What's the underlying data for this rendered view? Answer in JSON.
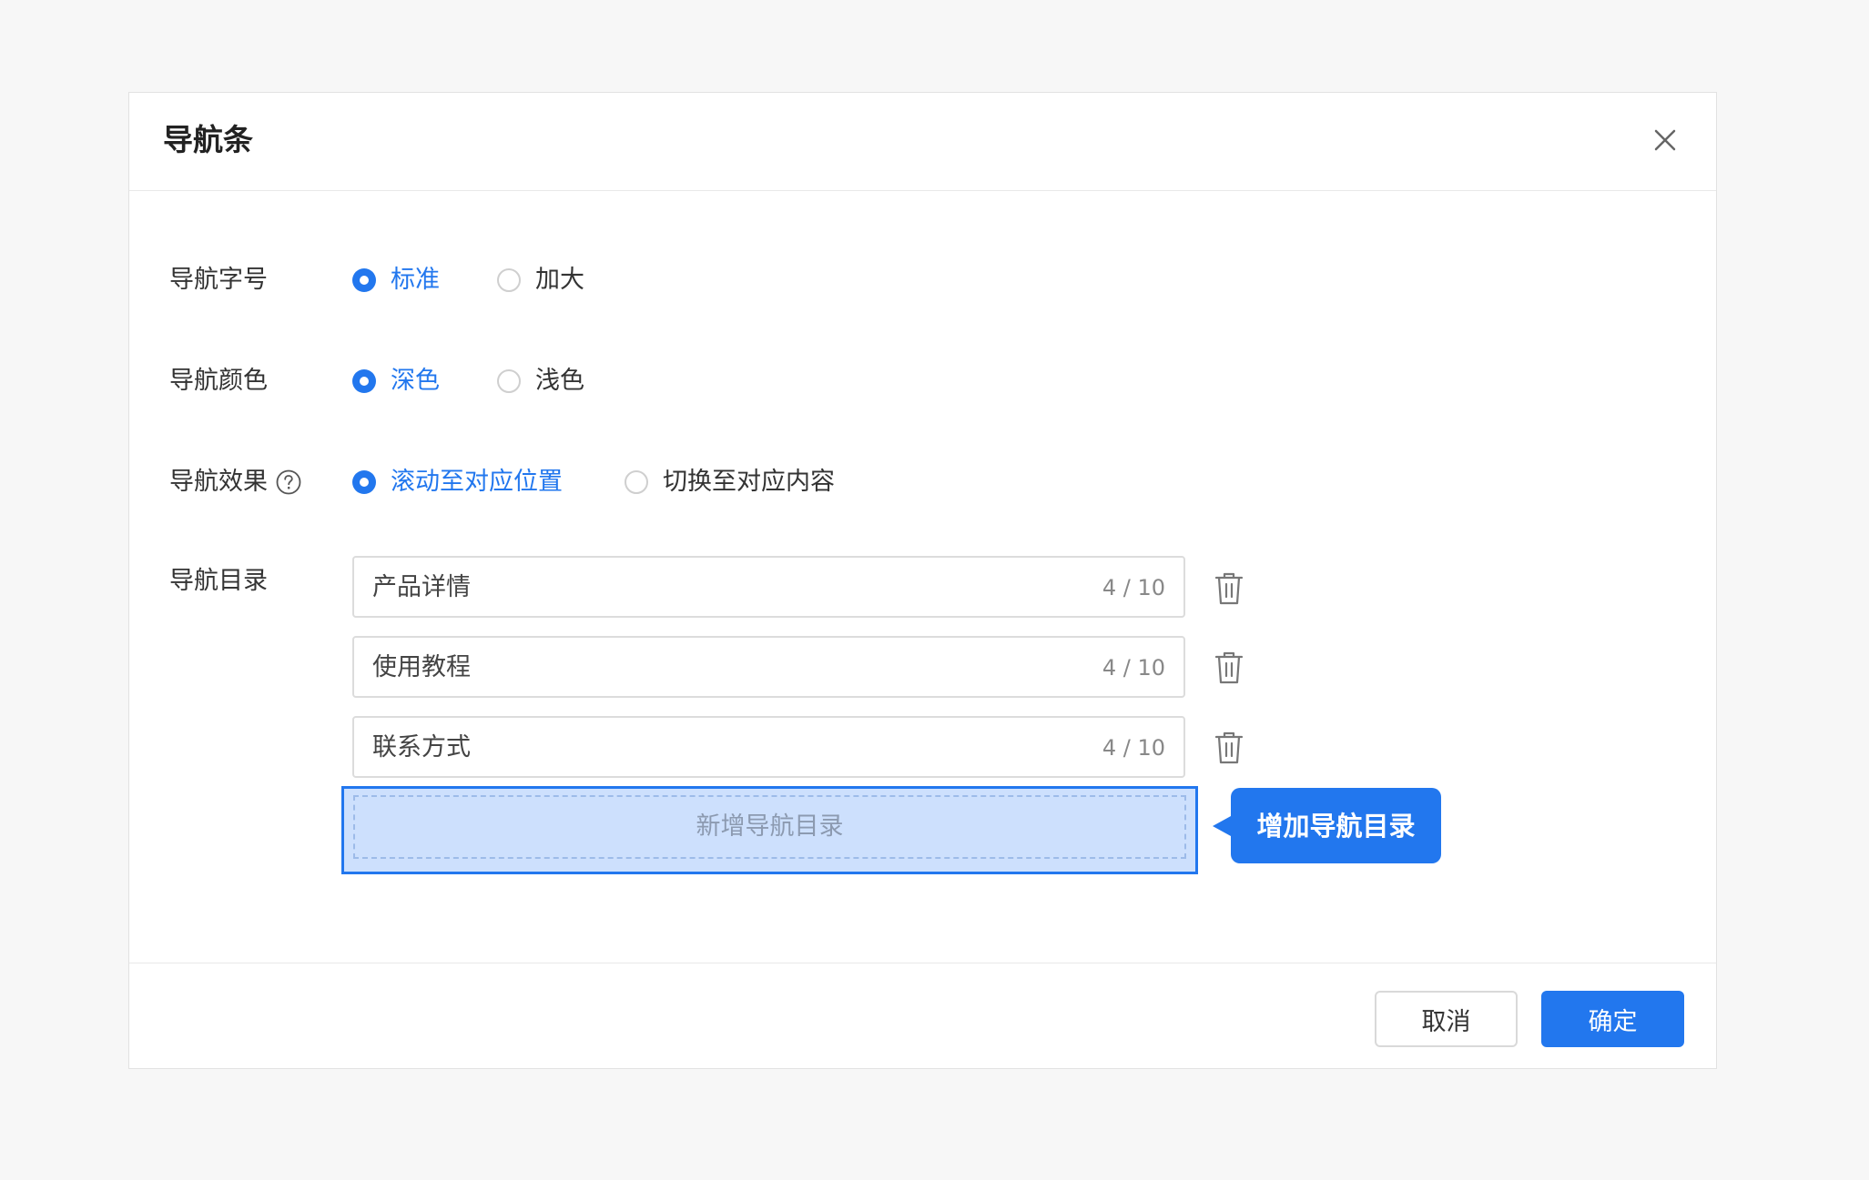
{
  "dialog": {
    "title": "导航条",
    "close_icon": "close-icon"
  },
  "form": {
    "font_size": {
      "label": "导航字号",
      "options": [
        {
          "label": "标准",
          "checked": true
        },
        {
          "label": "加大",
          "checked": false
        }
      ]
    },
    "color": {
      "label": "导航颜色",
      "options": [
        {
          "label": "深色",
          "checked": true
        },
        {
          "label": "浅色",
          "checked": false
        }
      ]
    },
    "effect": {
      "label": "导航效果",
      "help_icon": "question-circle-icon",
      "options": [
        {
          "label": "滚动至对应位置",
          "checked": true
        },
        {
          "label": "切换至对应内容",
          "checked": false
        }
      ]
    },
    "directory": {
      "label": "导航目录",
      "items": [
        {
          "value": "产品详情",
          "count": "4 / 10"
        },
        {
          "value": "使用教程",
          "count": "4 / 10"
        },
        {
          "value": "联系方式",
          "count": "4 / 10"
        }
      ],
      "delete_icon": "trash-icon",
      "add_label": "新增导航目录",
      "callout": "增加导航目录"
    }
  },
  "footer": {
    "cancel_label": "取消",
    "confirm_label": "确定"
  },
  "colors": {
    "accent": "#2277ee",
    "highlight_fill": "#cde0fd"
  }
}
